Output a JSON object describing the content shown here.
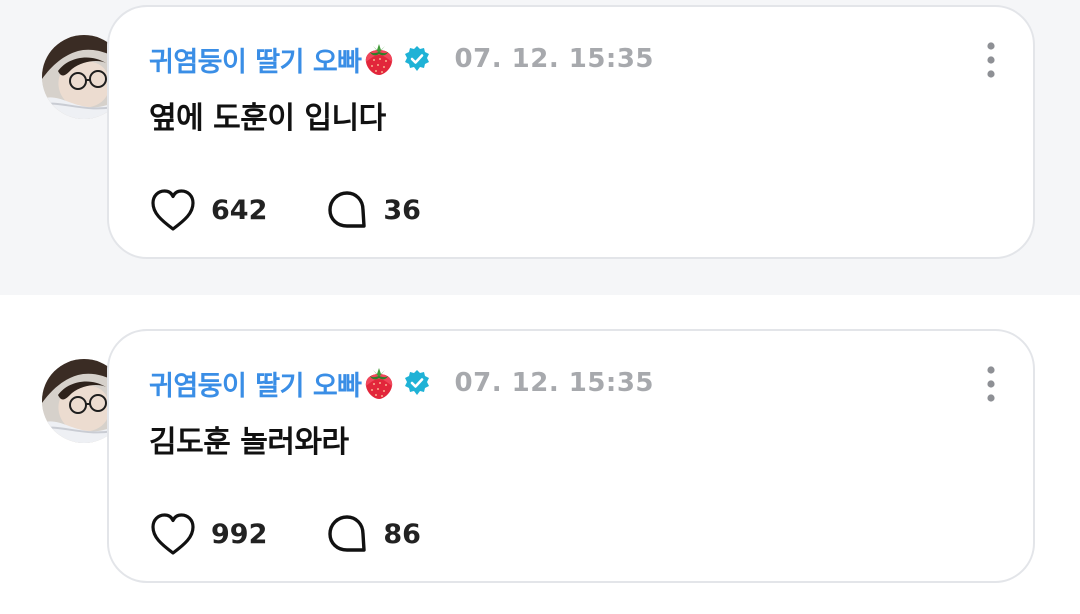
{
  "colors": {
    "author": "#3a8ee6",
    "verified_badge": "#1fb2d6",
    "timestamp": "#a7a9ad",
    "card_border": "#e3e5e9",
    "top_band_background": "#f5f6f8"
  },
  "posts": [
    {
      "author": "귀염둥이 딸기 오빠",
      "author_emoji_icon": "strawberry-icon",
      "verified_icon": "verified-badge-icon",
      "timestamp": "07. 12. 15:35",
      "content": "옆에 도훈이 입니다",
      "likes": "642",
      "comments": "36",
      "like_icon": "heart-icon",
      "comment_icon": "comment-bubble-icon",
      "menu_icon": "more-vertical-icon"
    },
    {
      "author": "귀염둥이 딸기 오빠",
      "author_emoji_icon": "strawberry-icon",
      "verified_icon": "verified-badge-icon",
      "timestamp": "07. 12. 15:35",
      "content": "김도훈 놀러와라",
      "likes": "992",
      "comments": "86",
      "like_icon": "heart-icon",
      "comment_icon": "comment-bubble-icon",
      "menu_icon": "more-vertical-icon"
    }
  ]
}
